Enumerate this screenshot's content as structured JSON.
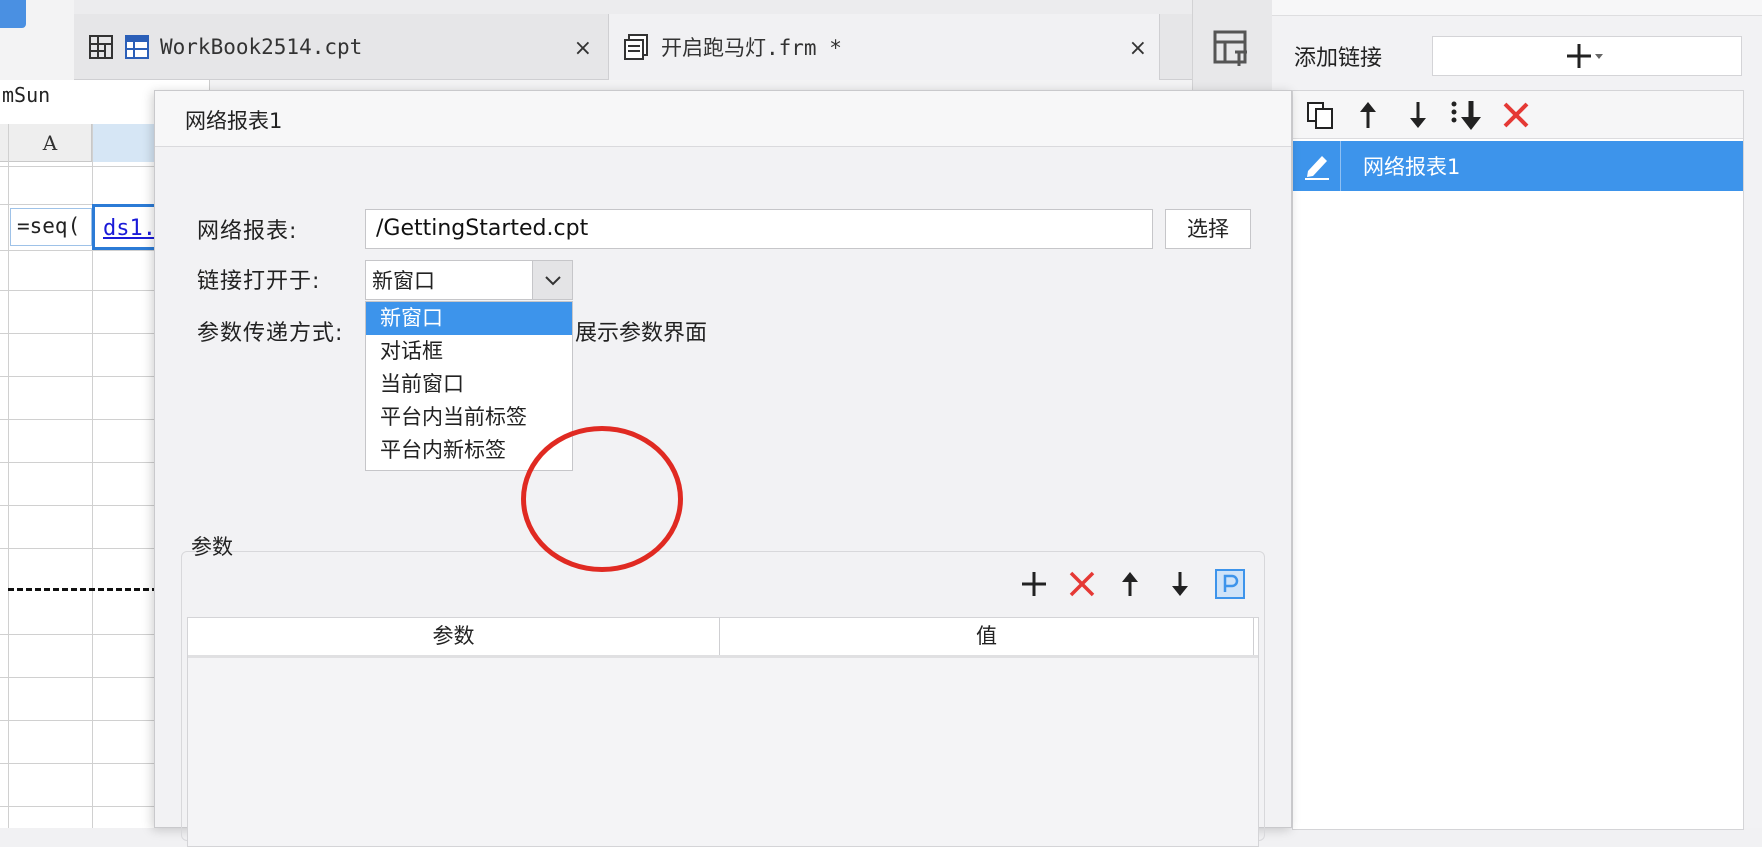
{
  "tabs": [
    {
      "label": "WorkBook2514.cpt",
      "close": "×"
    },
    {
      "label": "开启跑马灯.frm *",
      "close": "×"
    }
  ],
  "toolbar": {
    "font_name": "mSun"
  },
  "grid": {
    "column_a": "A",
    "formula_cell": "=seq(",
    "link_cell": "ds1."
  },
  "dialog": {
    "title": "网络报表1",
    "report_label": "网络报表:",
    "report_value": "/GettingStarted.cpt",
    "choose_button": "选择",
    "open_in_label": "链接打开于:",
    "open_in_value": "新窗口",
    "open_in_options": [
      "新窗口",
      "对话框",
      "当前窗口",
      "平台内当前标签",
      "平台内新标签"
    ],
    "param_mode_label": "参数传递方式:",
    "show_param_text": "展示参数界面",
    "param_group_label": "参数",
    "param_table": {
      "columns": [
        "参数",
        "值"
      ],
      "rows": []
    }
  },
  "side_panel": {
    "add_link_label": "添加链接",
    "links": [
      {
        "label": "网络报表1"
      }
    ]
  },
  "colors": {
    "selection": "#3d94eb",
    "annotation_circle": "#e02a22",
    "delete_icon": "#e53935"
  }
}
